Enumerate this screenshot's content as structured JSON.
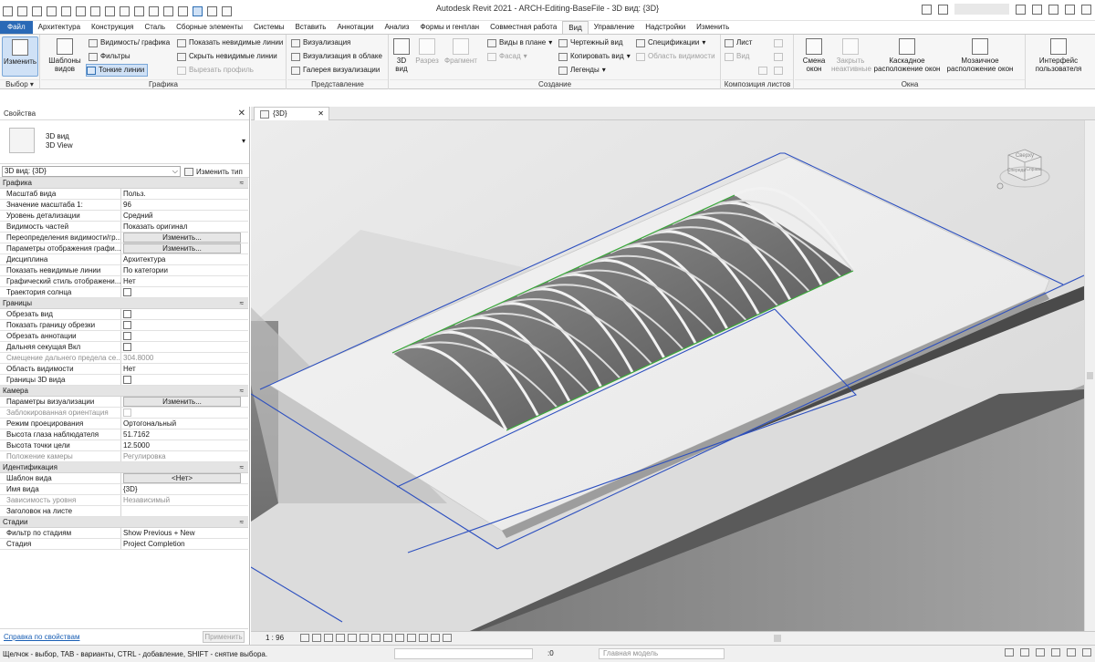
{
  "window": {
    "title": "Autodesk Revit 2021 - ARCH-Editing-BaseFile - 3D вид: {3D}"
  },
  "ribbon_tabs": [
    {
      "label": "Файл",
      "state": "file"
    },
    {
      "label": "Архитектура"
    },
    {
      "label": "Конструкция"
    },
    {
      "label": "Сталь"
    },
    {
      "label": "Сборные элементы"
    },
    {
      "label": "Системы"
    },
    {
      "label": "Вставить"
    },
    {
      "label": "Аннотации"
    },
    {
      "label": "Анализ"
    },
    {
      "label": "Формы и генплан"
    },
    {
      "label": "Совместная работа"
    },
    {
      "label": "Вид",
      "state": "active"
    },
    {
      "label": "Управление"
    },
    {
      "label": "Надстройки"
    },
    {
      "label": "Изменить"
    }
  ],
  "ribbon": {
    "select": {
      "modify": "Изменить",
      "title": "Выбор ▾"
    },
    "graphics": {
      "view_templates": "Шаблоны видов",
      "visibility": "Видимость/ графика",
      "filters": "Фильтры",
      "thin_lines": "Тонкие линии",
      "show_hidden": "Показать невидимые линии",
      "hide_hidden": "Скрыть невидимые линии",
      "cut_profile": "Вырезать профиль",
      "title": "Графика"
    },
    "presentation": {
      "render": "Визуализация",
      "render_cloud": "Визуализация  в облаке",
      "gallery": "Галерея  визуализации",
      "title": "Представление"
    },
    "create": {
      "view3d": "3D вид",
      "section": "Разрез",
      "callout": "Фрагмент",
      "plan_views": "Виды в плане",
      "elevation": "Фасад",
      "drafting": "Чертежный вид",
      "duplicate": "Копировать вид",
      "legends": "Легенды",
      "schedules": "Спецификации",
      "scope_box": "Область видимости",
      "title": "Создание"
    },
    "sheet": {
      "sheet": "Лист",
      "view": "Вид",
      "title": "Композиция листов"
    },
    "windows": {
      "switch": "Смена окон",
      "close_inactive": "Закрыть неактивные",
      "cascade": "Каскадное расположение окон",
      "tile": "Мозаичное расположение окон",
      "title": "Окна"
    },
    "ui": {
      "label": "Интерфейс пользователя"
    }
  },
  "properties": {
    "title": "Свойства",
    "type_line1": "3D вид",
    "type_line2": "3D View",
    "instance": "3D вид: {3D}",
    "edit_type": "Изменить тип",
    "help": "Справка по свойствам",
    "apply": "Применить",
    "sections": [
      {
        "name": "Графика",
        "rows": [
          {
            "n": "Масштаб вида",
            "v": "Польз."
          },
          {
            "n": "Значение масштаба    1:",
            "v": "96"
          },
          {
            "n": "Уровень детализации",
            "v": "Средний"
          },
          {
            "n": "Видимость частей",
            "v": "Показать оригинал"
          },
          {
            "n": "Переопределения видимости/гр...",
            "v": "Изменить...",
            "btn": true
          },
          {
            "n": "Параметры отображения графи...",
            "v": "Изменить...",
            "btn": true
          },
          {
            "n": "Дисциплина",
            "v": "Архитектура"
          },
          {
            "n": "Показать невидимые линии",
            "v": "По категории"
          },
          {
            "n": "Графический стиль отображени...",
            "v": "Нет"
          },
          {
            "n": "Траектория солнца",
            "chk": true
          }
        ]
      },
      {
        "name": "Границы",
        "rows": [
          {
            "n": "Обрезать вид",
            "chk": true
          },
          {
            "n": "Показать границу обрезки",
            "chk": true
          },
          {
            "n": "Обрезать аннотации",
            "chk": true
          },
          {
            "n": "Дальняя секущая Вкл",
            "chk": true
          },
          {
            "n": "Смещение дальнего предела се...",
            "v": "304.8000",
            "dis": true
          },
          {
            "n": "Область видимости",
            "v": "Нет"
          },
          {
            "n": "Границы 3D вида",
            "chk": true
          }
        ]
      },
      {
        "name": "Камера",
        "rows": [
          {
            "n": "Параметры визуализации",
            "v": "Изменить...",
            "btn": true
          },
          {
            "n": "Заблокированная ориентация",
            "chk": true,
            "dis": true
          },
          {
            "n": "Режим проецирования",
            "v": "Ортогональный"
          },
          {
            "n": "Высота глаза наблюдателя",
            "v": "51.7162"
          },
          {
            "n": "Высота точки цели",
            "v": "12.5000"
          },
          {
            "n": "Положение камеры",
            "v": "Регулировка",
            "dis": true
          }
        ]
      },
      {
        "name": "Идентификация",
        "rows": [
          {
            "n": "Шаблон вида",
            "v": "<Нет>",
            "btn": true
          },
          {
            "n": "Имя вида",
            "v": "{3D}"
          },
          {
            "n": "Зависимость уровня",
            "v": "Независимый",
            "dis": true
          },
          {
            "n": "Заголовок на листе",
            "v": ""
          }
        ]
      },
      {
        "name": "Стадии",
        "rows": [
          {
            "n": "Фильтр по стадиям",
            "v": "Show Previous + New"
          },
          {
            "n": "Стадия",
            "v": "Project Completion"
          }
        ]
      }
    ]
  },
  "view": {
    "tab_label": "{3D}",
    "scale": "1 : 96",
    "viewcube_faces": [
      "Сверху",
      "Спереди",
      "Справа"
    ]
  },
  "status": {
    "text": "Щелчок - выбор, TAB - варианты, CTRL - добавление, SHIFT - снятие выбора.",
    "count": ":0",
    "model": "Главная модель"
  },
  "colors": {
    "file_tab": "#2a69b6",
    "crop_line": "#2c4fbf",
    "skylight_edge": "#3aa83a"
  }
}
